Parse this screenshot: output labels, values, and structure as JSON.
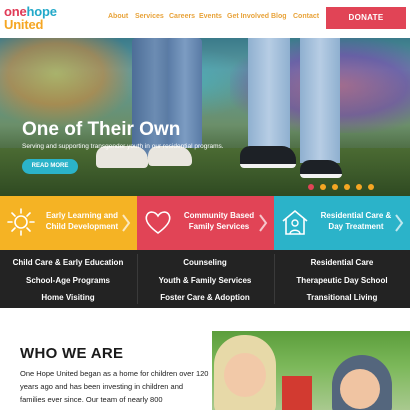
{
  "header": {
    "logo_line1_one": "one",
    "logo_line1_hope": "hope",
    "logo_line2": "United",
    "nav": [
      "About",
      "Services",
      "Careers",
      "Events",
      "Get Involved",
      "Blog",
      "Contact"
    ],
    "donate_label": "DONATE"
  },
  "hero": {
    "title": "One of Their Own",
    "subtitle": "Serving and supporting transgender youth in our residential programs.",
    "button_label": "READ MORE",
    "carousel_dots": 6,
    "active_dot": 0
  },
  "cards": [
    {
      "title": "Early Learning and Child Development",
      "color": "#f5b324",
      "icon": "sun-icon"
    },
    {
      "title": "Community Based Family Services",
      "color": "#e14456",
      "icon": "heart-icon"
    },
    {
      "title": "Residential Care & Day Treatment",
      "color": "#2bb3c9",
      "icon": "house-person-icon"
    }
  ],
  "programs": [
    [
      "Child Care & Early Education",
      "Counseling",
      "Residential Care"
    ],
    [
      "School-Age Programs",
      "Youth & Family Services",
      "Therapeutic Day School"
    ],
    [
      "Home Visiting",
      "Foster Care & Adoption",
      "Transitional Living"
    ]
  ],
  "who": {
    "title": "WHO WE ARE",
    "text": "One Hope United began as a home for children over 120 years ago and has been investing in children and families ever since. Our team  of nearly 800"
  },
  "colors": {
    "accent_red": "#e14456",
    "accent_yellow": "#f5b324",
    "accent_teal": "#2bb3c9",
    "nav_text": "#e8a33a",
    "dark_bg": "#232323"
  }
}
